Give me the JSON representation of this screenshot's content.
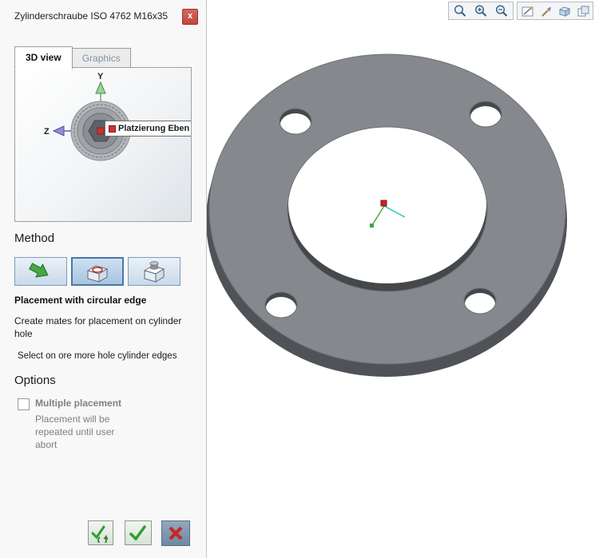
{
  "colors": {
    "close_button": "#c9574f",
    "selected_method_border": "#4878a8",
    "flange_top": "#85888c",
    "flange_side": "#4f5256",
    "confirm_green": "#2f9e2f",
    "cancel_red": "#c22a22"
  },
  "panel": {
    "title": "Zylinderschraube ISO 4762 M16x35",
    "close_label": "x",
    "tabs": {
      "view3d": "3D view",
      "graphics": "Graphics"
    },
    "preview": {
      "axis_y": "Y",
      "axis_z": "Z",
      "tooltip": "Platzierung Eben"
    },
    "method": {
      "heading": "Method",
      "selected_title": "Placement with circular edge",
      "description": "Create mates for placement on cylinder hole",
      "instruction": "Select on ore more hole cylinder edges"
    },
    "options": {
      "heading": "Options",
      "multiple_placement_label": "Multiple placement",
      "multiple_placement_description": "Placement will be repeated until user abort",
      "multiple_placement_checked": false
    }
  },
  "viewport": {
    "toolbar_groups": [
      {
        "icons": [
          "zoom-window-icon",
          "zoom-in-icon",
          "zoom-out-icon"
        ]
      },
      {
        "icons": [
          "sketch-icon",
          "render-icon",
          "part-icon",
          "windows-icon"
        ]
      }
    ]
  }
}
